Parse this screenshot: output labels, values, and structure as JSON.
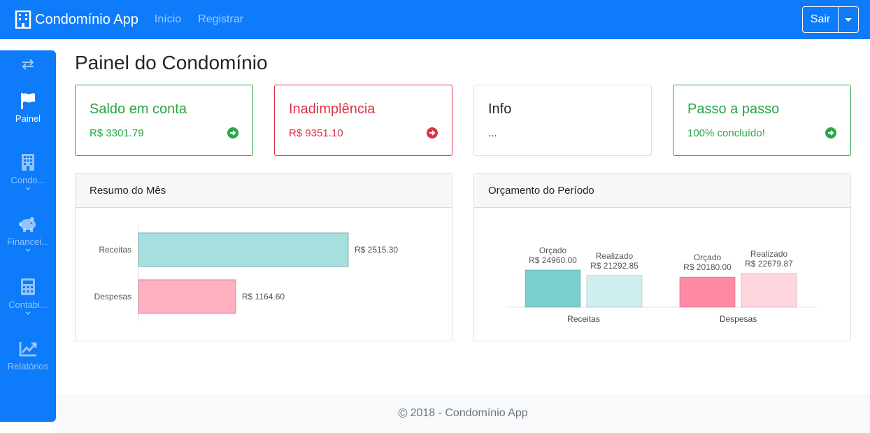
{
  "navbar": {
    "brand": "Condomínio App",
    "links": [
      "Início",
      "Registrar"
    ],
    "logout_label": "Sair"
  },
  "sidebar": {
    "items": [
      {
        "label": "Painel",
        "icon": "flag-icon",
        "active": true
      },
      {
        "label": "Condo...",
        "icon": "building-icon",
        "active": false
      },
      {
        "label": "Financei...",
        "icon": "piggy-bank-icon",
        "active": false
      },
      {
        "label": "Contabi...",
        "icon": "calculator-icon",
        "active": false
      },
      {
        "label": "Relatórios",
        "icon": "chart-line-icon",
        "active": false
      }
    ]
  },
  "page": {
    "title": "Painel do Condomínio"
  },
  "stats": [
    {
      "title": "Saldo em conta",
      "value": "R$ 3301.79",
      "color": "#28a745"
    },
    {
      "title": "Inadimplência",
      "value": "R$ 9351.10",
      "color": "#dc3545"
    },
    {
      "title": "Info",
      "value": "...",
      "color": "#212529"
    },
    {
      "title": "Passo a passo",
      "value": "100% concluído!",
      "color": "#28a745"
    }
  ],
  "colors": {
    "primary": "#0d7bfa",
    "success": "#28a745",
    "danger": "#dc3545"
  },
  "summary": {
    "header": "Resumo do Mês",
    "chart_data": {
      "type": "bar",
      "orientation": "horizontal",
      "categories": [
        "Receitas",
        "Despesas"
      ],
      "values": [
        2515.3,
        1164.6
      ],
      "value_labels": [
        "R$ 2515.30",
        "R$ 1164.60"
      ],
      "colors": [
        "#a6dfe0",
        "#ffb0c0"
      ]
    }
  },
  "budget": {
    "header": "Orçamento do Período",
    "chart_data": {
      "type": "bar",
      "categories": [
        "Receitas",
        "Despesas"
      ],
      "series": [
        {
          "name": "Orçado",
          "values": [
            24960.0,
            20180.0
          ],
          "labels": [
            "R$ 24960.00",
            "R$ 20180.00"
          ],
          "colors": [
            "#7ccfcf",
            "#ff8aa4"
          ]
        },
        {
          "name": "Realizado",
          "values": [
            21292.85,
            22679.87
          ],
          "labels": [
            "R$ 21292.85",
            "R$ 22679.87"
          ],
          "colors": [
            "#d0efef",
            "#ffd6de"
          ]
        }
      ]
    }
  },
  "footer": {
    "copy_symbol": "©",
    "text": "2018 - Condomínio App"
  }
}
